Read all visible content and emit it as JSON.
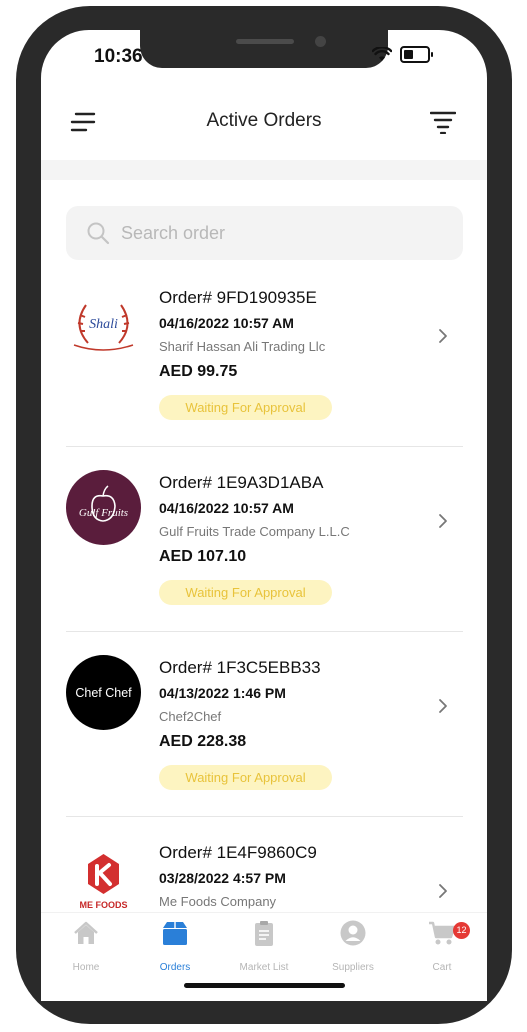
{
  "status_bar": {
    "time": "10:36"
  },
  "header": {
    "title": "Active Orders"
  },
  "search": {
    "placeholder": "Search order"
  },
  "orders": [
    {
      "order_no": "Order# 9FD190935E",
      "date": "04/16/2022 10:57 AM",
      "company": "Sharif Hassan Ali Trading Llc",
      "amount": "AED 99.75",
      "status": "Waiting For Approval",
      "logo_text": "Shali"
    },
    {
      "order_no": "Order# 1E9A3D1ABA",
      "date": "04/16/2022 10:57 AM",
      "company": "Gulf Fruits Trade Company L.L.C",
      "amount": "AED 107.10",
      "status": "Waiting For Approval",
      "logo_text": "Gulf Fruits"
    },
    {
      "order_no": "Order# 1F3C5EBB33",
      "date": "04/13/2022 1:46 PM",
      "company": "Chef2Chef",
      "amount": "AED 228.38",
      "status": "Waiting For Approval",
      "logo_text": "Chef Chef"
    },
    {
      "order_no": "Order# 1E4F9860C9",
      "date": "03/28/2022 4:57 PM",
      "company": "Me Foods Company",
      "amount": "",
      "status": "",
      "logo_text": "ME FOODS"
    }
  ],
  "nav": {
    "home": "Home",
    "orders": "Orders",
    "market_list": "Market List",
    "suppliers": "Suppliers",
    "cart": "Cart",
    "cart_count": "12"
  },
  "colors": {
    "accent": "#2a7fd8",
    "badge_bg": "#fdf4c1",
    "badge_text": "#e8c33b",
    "cart_badge": "#e53935"
  }
}
